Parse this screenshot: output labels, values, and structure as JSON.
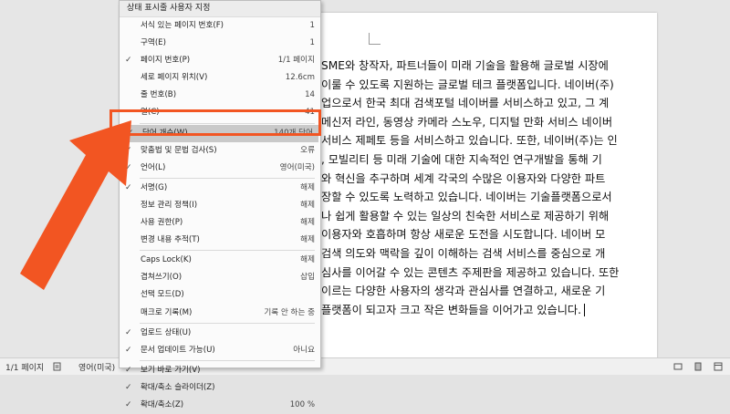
{
  "document": {
    "lines": [
      "SME와 창작자, 파트너들이 미래 기술을 활용해 글로벌 시장에",
      "이룰 수 있도록 지원하는 글로벌 테크 플랫폼입니다. 네이버(주)",
      "업으로서 한국 최대 검색포털 네이버를 서비스하고 있고, 그 계",
      "메신저 라인, 동영상 카메라 스노우, 디지털 만화 서비스 네이버",
      "서비스 제페토 등을 서비스하고 있습니다. 또한, 네이버(주)는 인",
      ", 모빌리티 등 미래 기술에 대한 지속적인 연구개발을 통해 기",
      "와 혁신을 추구하며 세계 각국의 수많은 이용자와 다양한 파트",
      "장할 수 있도록 노력하고 있습니다. 네이버는 기술플랫폼으로서",
      "나 쉽게 활용할 수 있는 일상의 친숙한 서비스로 제공하기 위해",
      "이용자와 호흡하며 항상 새로운 도전을 시도합니다. 네이버 모",
      "검색 의도와 맥락을 깊이 이해하는 검색 서비스를 중심으로 개",
      "심사를 이어갈 수 있는 콘텐츠 주제판을 제공하고 있습니다. 또한",
      "이르는 다양한 사용자의 생각과 관심사를 연결하고, 새로운 기",
      "플랫폼이 되고자 크고 작은 변화들을 이어가고 있습니다."
    ]
  },
  "statusbar": {
    "page": "1/1 페이지",
    "language": "영어(미국)"
  },
  "menu": {
    "title": "상태 표시줄 사용자 지정",
    "items": [
      {
        "check": "",
        "label": "서식 있는 페이지 번호(F)",
        "value": "1"
      },
      {
        "check": "",
        "label": "구역(E)",
        "value": "1"
      },
      {
        "check": "✓",
        "label": "페이지 번호(P)",
        "value": "1/1 페이지"
      },
      {
        "check": "",
        "label": "세로 페이지 위치(V)",
        "value": "12.6cm"
      },
      {
        "check": "",
        "label": "줄 번호(B)",
        "value": "14"
      },
      {
        "check": "",
        "label": "열(C)",
        "value": "41"
      },
      {
        "check": "✓",
        "label": "단어 개수(W)",
        "value": "140개 단어"
      },
      {
        "check": "✓",
        "label": "맞춤법 및 문법 검사(S)",
        "value": "오류"
      },
      {
        "check": "✓",
        "label": "언어(L)",
        "value": "영어(미국)"
      },
      {
        "check": "✓",
        "label": "서명(G)",
        "value": "해제"
      },
      {
        "check": "",
        "label": "정보 관리 정책(I)",
        "value": "해제"
      },
      {
        "check": "",
        "label": "사용 권한(P)",
        "value": "해제"
      },
      {
        "check": "",
        "label": "변경 내용 추적(T)",
        "value": "해제"
      },
      {
        "check": "",
        "label": "Caps Lock(K)",
        "value": "해제"
      },
      {
        "check": "",
        "label": "겹쳐쓰기(O)",
        "value": "삽입"
      },
      {
        "check": "",
        "label": "선택 모드(D)",
        "value": ""
      },
      {
        "check": "",
        "label": "매크로 기록(M)",
        "value": "기록 안 하는 중"
      },
      {
        "check": "✓",
        "label": "업로드 상태(U)",
        "value": ""
      },
      {
        "check": "✓",
        "label": "문서 업데이트 가능(U)",
        "value": "아니요"
      },
      {
        "check": "✓",
        "label": "보기 바로 가기(V)",
        "value": ""
      },
      {
        "check": "✓",
        "label": "확대/축소 슬라이더(Z)",
        "value": ""
      },
      {
        "check": "✓",
        "label": "확대/축소(Z)",
        "value": "100 %"
      }
    ]
  },
  "colors": {
    "accent_arrow": "#f25522",
    "menu_highlight": "#c9c9c9",
    "spell_underline": "#e03030"
  }
}
